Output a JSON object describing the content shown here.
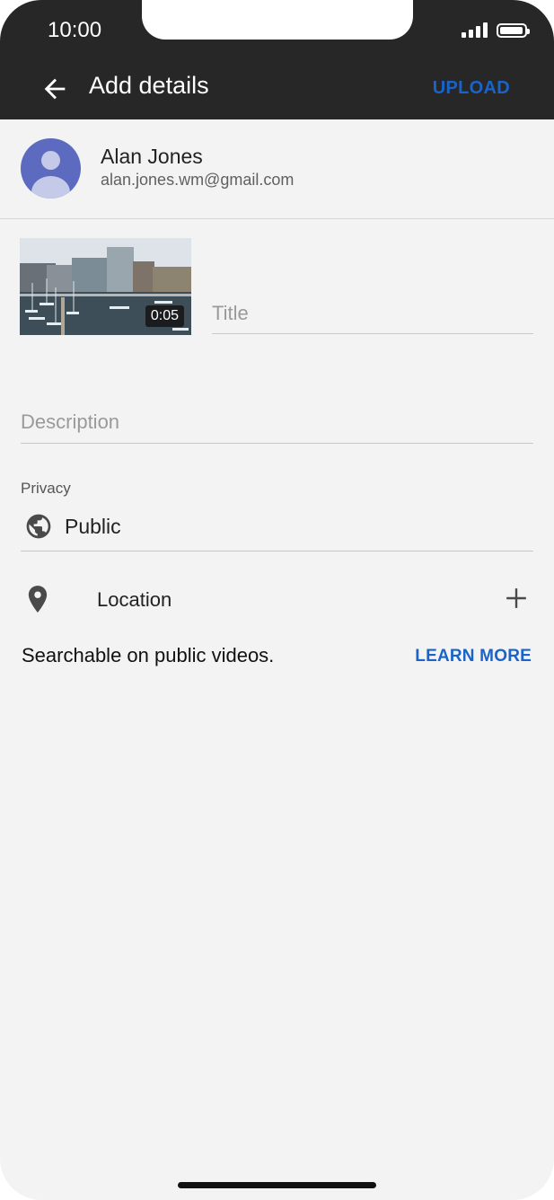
{
  "status_bar": {
    "time": "10:00"
  },
  "header": {
    "title": "Add details",
    "upload_label": "UPLOAD"
  },
  "account": {
    "name": "Alan Jones",
    "email": "alan.jones.wm@gmail.com"
  },
  "video": {
    "duration": "0:05"
  },
  "form": {
    "title_placeholder": "Title",
    "description_placeholder": "Description",
    "privacy_label": "Privacy",
    "privacy_value": "Public",
    "location_label": "Location"
  },
  "footer_note": {
    "text": "Searchable on public videos.",
    "link": "LEARN MORE"
  },
  "colors": {
    "header_bg": "#272727",
    "accent": "#1a63c9",
    "page_bg": "#f3f3f3",
    "avatar": "#5c6bc0"
  },
  "icons": [
    "back-arrow-icon",
    "signal-icon",
    "battery-icon",
    "globe-icon",
    "location-pin-icon",
    "plus-icon"
  ]
}
